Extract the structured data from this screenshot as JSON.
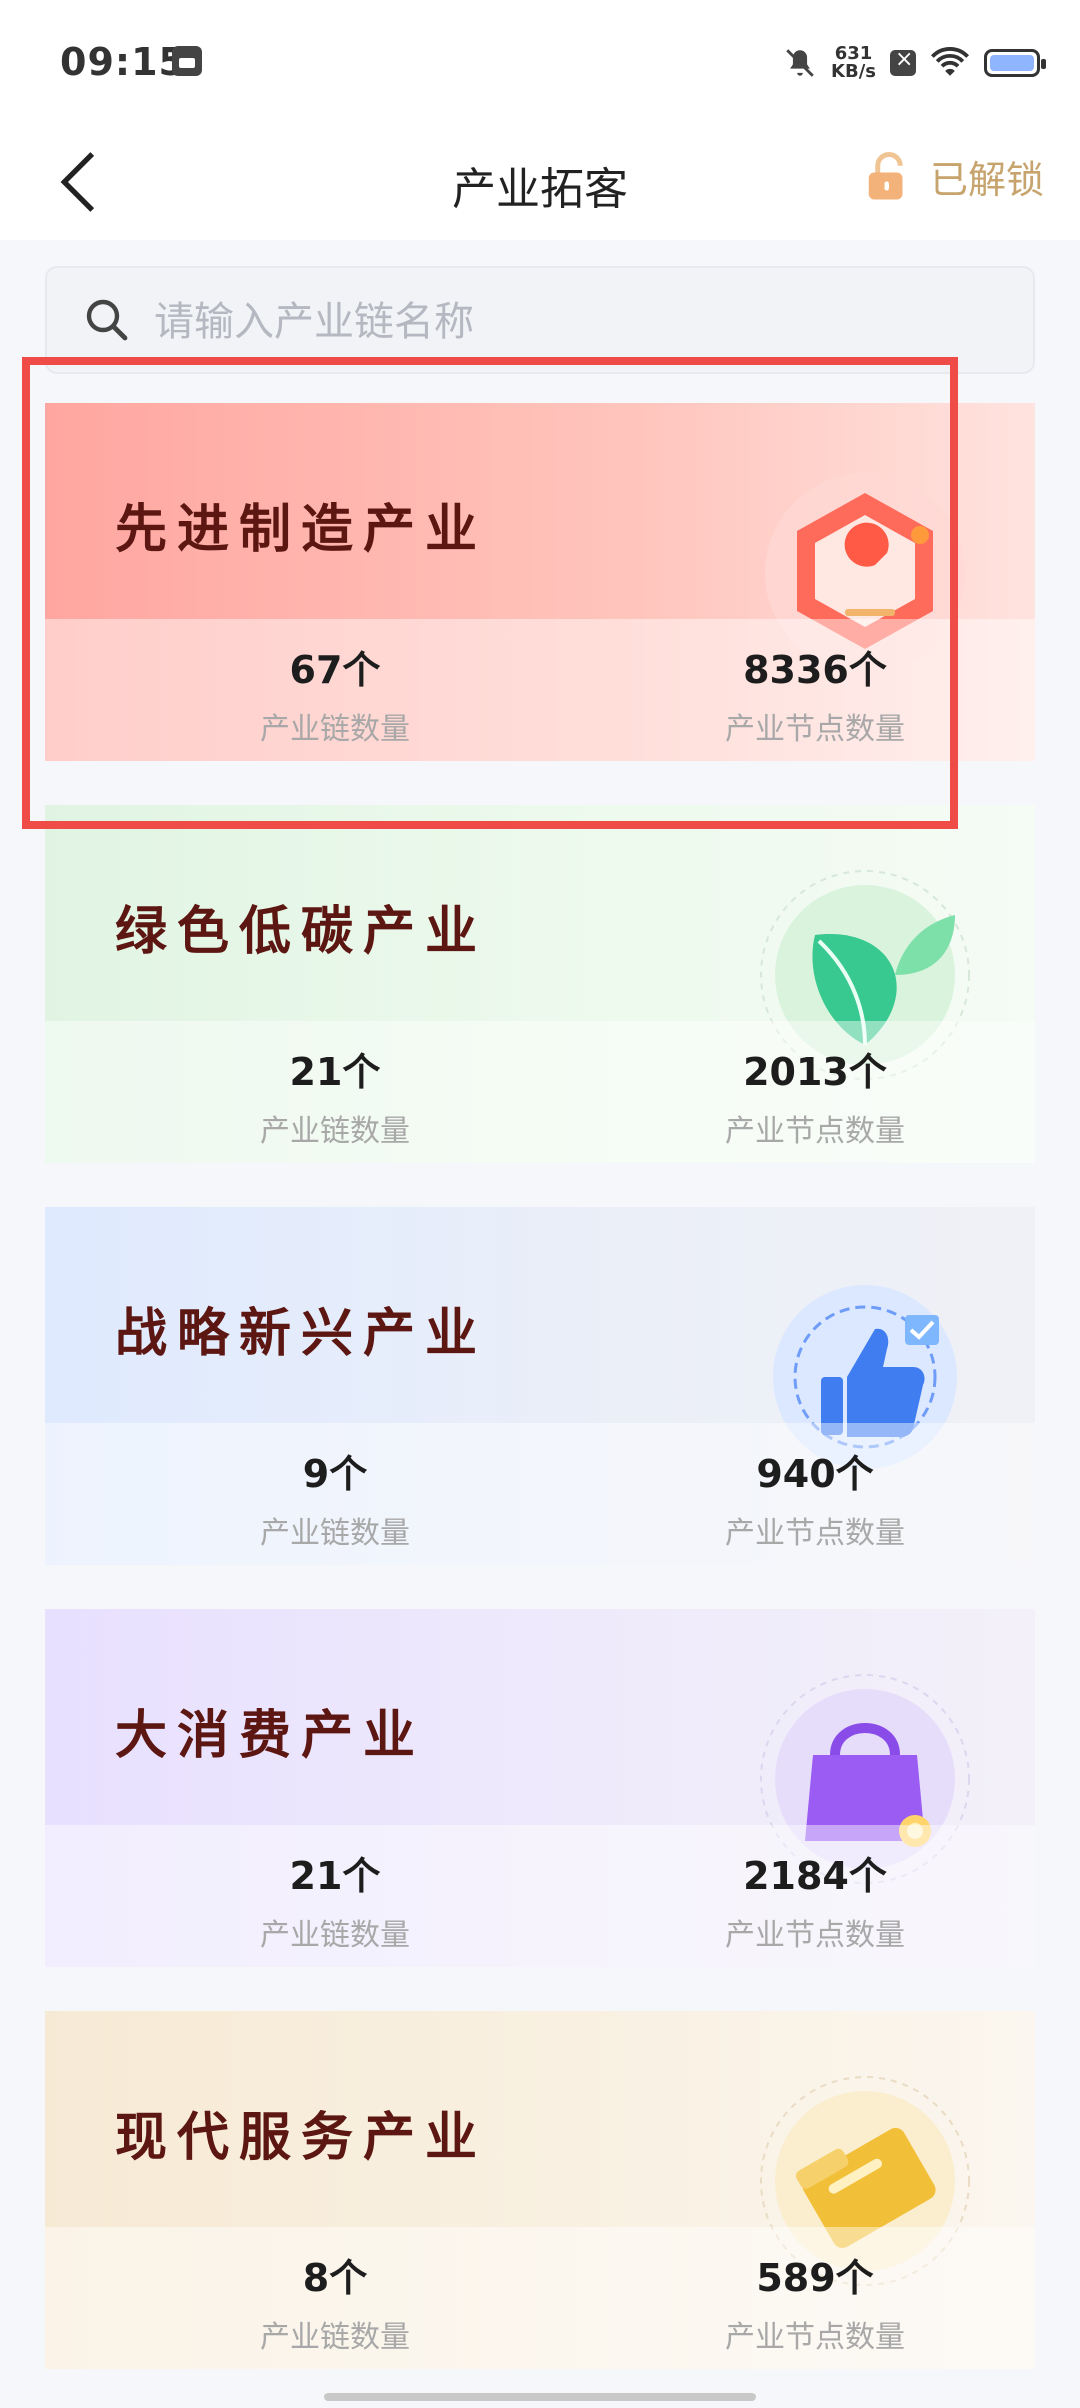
{
  "status_bar": {
    "time": "09:15",
    "network_speed_value": "631",
    "network_speed_unit": "KB/s",
    "icons": [
      "notification-app-icon",
      "mute-icon",
      "close-box-icon",
      "wifi-icon",
      "battery-icon"
    ]
  },
  "nav": {
    "back_icon": "chevron-left-icon",
    "title": "产业拓客",
    "unlock_icon": "unlock-icon",
    "unlock_label": "已解锁"
  },
  "search": {
    "icon": "search-icon",
    "placeholder": "请输入产业链名称",
    "value": ""
  },
  "cards": [
    {
      "title": "先进制造产业",
      "chains_value": "67个",
      "chains_label": "产业链数量",
      "nodes_value": "8336个",
      "nodes_label": "产业节点数量",
      "icon": "wrench-hexagon-icon",
      "color": "#ff6b5b"
    },
    {
      "title": "绿色低碳产业",
      "chains_value": "21个",
      "chains_label": "产业链数量",
      "nodes_value": "2013个",
      "nodes_label": "产业节点数量",
      "icon": "leaf-icon",
      "color": "#37c98f"
    },
    {
      "title": "战略新兴产业",
      "chains_value": "9个",
      "chains_label": "产业链数量",
      "nodes_value": "940个",
      "nodes_label": "产业节点数量",
      "icon": "thumbs-up-badge-icon",
      "color": "#3f7df0"
    },
    {
      "title": "大消费产业",
      "chains_value": "21个",
      "chains_label": "产业链数量",
      "nodes_value": "2184个",
      "nodes_label": "产业节点数量",
      "icon": "shopping-bag-icon",
      "color": "#9a5cf3"
    },
    {
      "title": "现代服务产业",
      "chains_value": "8个",
      "chains_label": "产业链数量",
      "nodes_value": "589个",
      "nodes_label": "产业节点数量",
      "icon": "folder-icon",
      "color": "#f1bf38"
    }
  ],
  "colors": {
    "accent_gold": "#c7a46d",
    "title_dark_red": "#5d1712",
    "highlight_red": "#ef4c48"
  }
}
